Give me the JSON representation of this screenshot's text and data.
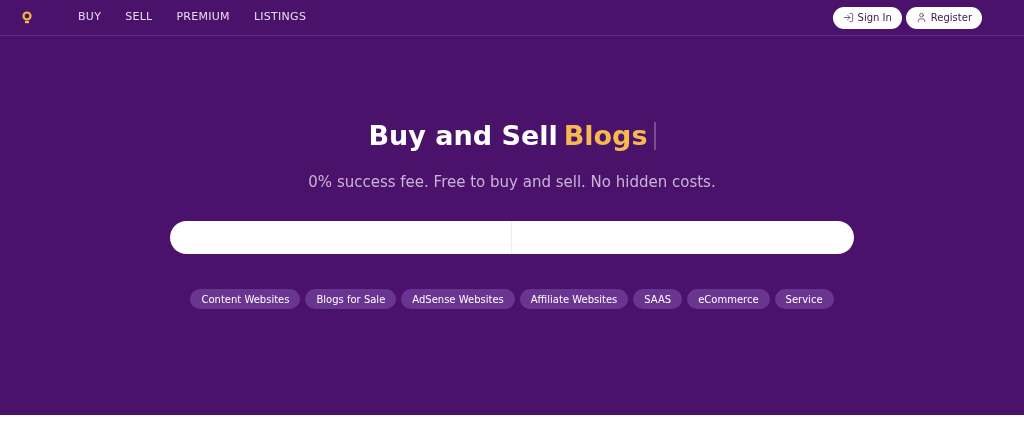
{
  "nav": {
    "links": [
      "BUY",
      "SELL",
      "PREMIUM",
      "LISTINGS"
    ],
    "buttons": [
      {
        "kind": "signin",
        "label": "Sign In"
      },
      {
        "kind": "register",
        "label": "Register"
      }
    ]
  },
  "hero": {
    "title": "Buy and Sell",
    "highlight": "Blogs",
    "subtitle": "0% success fee. Free to buy and sell. No hidden costs."
  },
  "tags": [
    "Content Websites",
    "Blogs for Sale",
    "AdSense Websites",
    "Affiliate Websites",
    "SAAS",
    "eCommerce",
    "Service"
  ]
}
